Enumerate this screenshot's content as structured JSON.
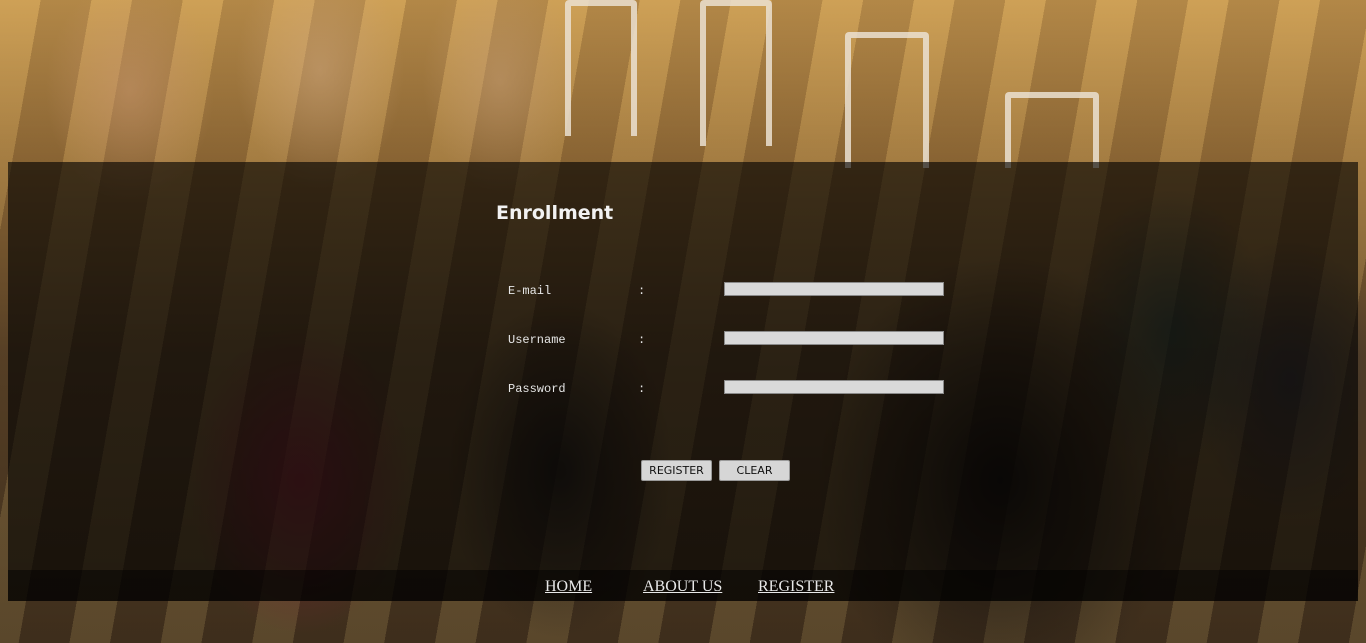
{
  "form": {
    "title": "Enrollment",
    "fields": [
      {
        "label": "E-mail",
        "separator": ":",
        "value": ""
      },
      {
        "label": "Username",
        "separator": ":",
        "value": ""
      },
      {
        "label": "Password",
        "separator": ":",
        "value": ""
      }
    ],
    "register_label": "REGISTER",
    "clear_label": "CLEAR"
  },
  "nav": {
    "items": [
      {
        "label": "HOME"
      },
      {
        "label": "ABOUT US"
      },
      {
        "label": "REGISTER"
      }
    ]
  },
  "colors": {
    "panel_overlay": "#000000",
    "input_background": "#d9d9d9",
    "text_light": "#f2f2f2"
  }
}
